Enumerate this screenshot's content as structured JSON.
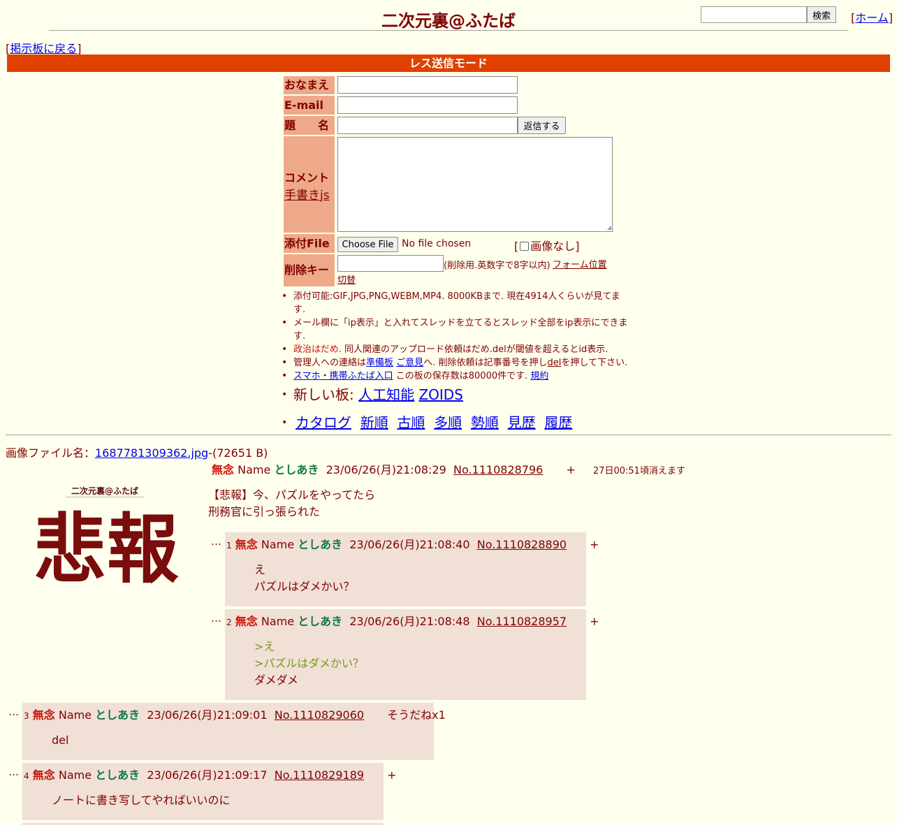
{
  "header": {
    "title": "二次元裏@ふたば",
    "search_button": "検索",
    "home_link": "ホーム"
  },
  "back_link": "掲示板に戻る",
  "mode_bar": "レス送信モード",
  "form": {
    "name_label": "おなまえ",
    "email_label": "E-mail",
    "subject_label": "題　　名",
    "submit_button": "返信する",
    "comment_label": "コメント",
    "handwriting_link": "手書きjs",
    "file_label": "添付File",
    "file_button": "Choose File",
    "file_status": "No file chosen",
    "noimage_label": "画像なし",
    "delkey_label": "削除キー",
    "delkey_note": "(削除用.英数字で8字以内)",
    "form_pos_link": "フォーム位置切替"
  },
  "notes": {
    "n1": "添付可能:GIF,JPG,PNG,WEBM,MP4. 8000KBまで. 現在4914人くらいが見てます.",
    "n2": "メール欄に「ip表示」と入れてスレッドを立てるとスレッド全部をip表示にできます.",
    "n3a": "政治はだめ.",
    "n3b": " 同人関連のアップロード依頼はだめ.delが閾値を超えるとid表示.",
    "n4a": "管理人への連絡は",
    "n4_link1": "準備板",
    "n4_link2": "ご意見",
    "n4b": "へ. 削除依頼は記事番号を押し",
    "n4_link3": "del",
    "n4c": "を押して下さい.",
    "n5_link": "スマホ・携帯ふたば入口",
    "n5b": " この板の保存数は80000件です. ",
    "n5_link2": "規約",
    "new_boards_label": "新しい板: ",
    "new_board_1": "人工知能",
    "new_board_2": "ZOIDS",
    "nav": [
      "カタログ",
      "新順",
      "古順",
      "多順",
      "勢順",
      "見歴",
      "履歴"
    ]
  },
  "op": {
    "file_label": "画像ファイル名：",
    "file_name": "1687781309362.jpg",
    "file_size": "-(72651 B)",
    "subject": "無念",
    "name_label": "Name",
    "name": "としあき",
    "date": "23/06/26(月)21:08:29",
    "no": "No.1110828796",
    "plus": "+",
    "expire": "27日00:51頃消えます",
    "body_1": "【悲報】今、パズルをやってたら",
    "body_2": "刑務官に引っ張られた",
    "thumb_caption": "二次元裏@ふたば",
    "thumb_text": "悲報"
  },
  "replies": [
    {
      "dots": "…",
      "num": "1",
      "subject": "無念",
      "name_label": "Name",
      "name": "としあき",
      "date": "23/06/26(月)21:08:40",
      "no": "No.1110828890",
      "plus": "+",
      "line_1": "え",
      "line_2": "パズルはダメかい？"
    },
    {
      "dots": "…",
      "num": "2",
      "subject": "無念",
      "name_label": "Name",
      "name": "としあき",
      "date": "23/06/26(月)21:08:48",
      "no": "No.1110828957",
      "plus": "+",
      "quote_1": ">え",
      "quote_2": ">パズルはダメかい？",
      "line_1": "ダメダメ"
    },
    {
      "dots": "…",
      "num": "3",
      "subject": "無念",
      "name_label": "Name",
      "name": "としあき",
      "date": "23/06/26(月)21:09:01",
      "no": "No.1110829060",
      "sodane": "そうだねx1",
      "line_1": "del"
    },
    {
      "dots": "…",
      "num": "4",
      "subject": "無念",
      "name_label": "Name",
      "name": "としあき",
      "date": "23/06/26(月)21:09:17",
      "no": "No.1110829189",
      "plus": "+",
      "line_1": "ノートに書き写してやればいいのに"
    }
  ]
}
